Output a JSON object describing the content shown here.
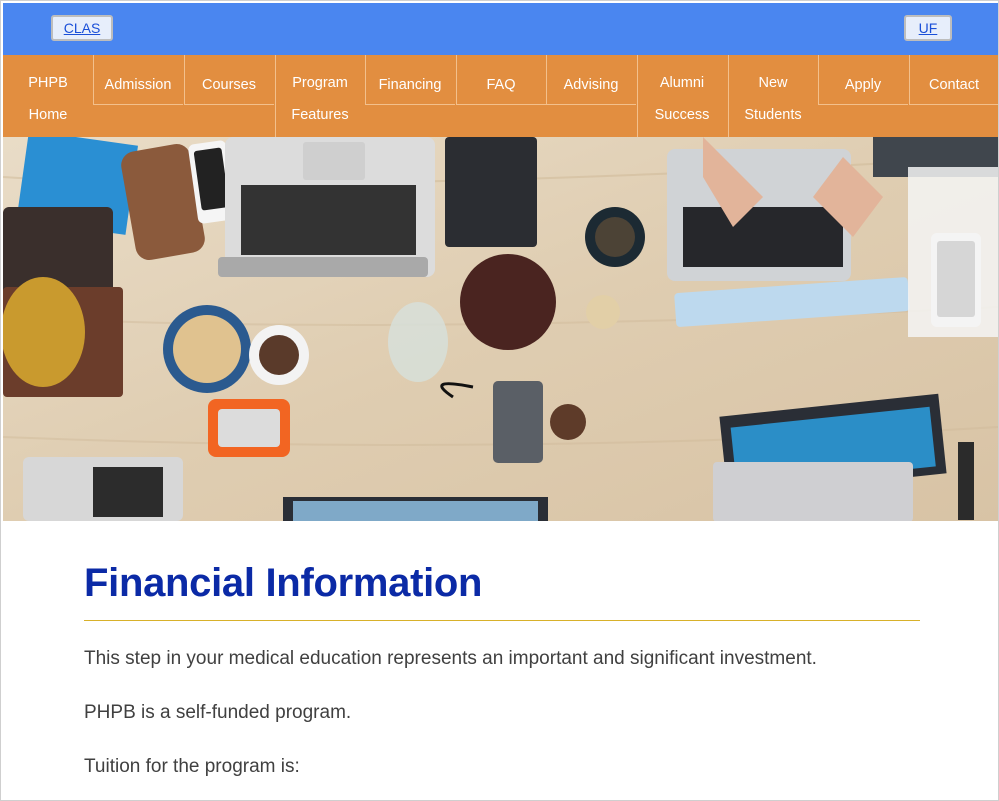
{
  "header": {
    "left_link": "CLAS",
    "right_link": "UF"
  },
  "nav": {
    "items": [
      {
        "label": "PHPB\nHome"
      },
      {
        "label": "Admission"
      },
      {
        "label": "Courses"
      },
      {
        "label": "Program\nFeatures"
      },
      {
        "label": "Financing"
      },
      {
        "label": "FAQ"
      },
      {
        "label": "Advising"
      },
      {
        "label": "Alumni\nSuccess"
      },
      {
        "label": "New\nStudents"
      },
      {
        "label": "Apply"
      },
      {
        "label": "Contact"
      }
    ]
  },
  "hero": {
    "icon": "desk-with-laptops-photo"
  },
  "main": {
    "title": "Financial Information",
    "paragraphs": [
      "This step in your medical education represents an important and significant investment.",
      "PHPB is a self-funded program.",
      "Tuition for the program is:"
    ]
  },
  "colors": {
    "topbar": "#4a86f0",
    "nav": "#e28e40",
    "title": "#0b2aa6",
    "rule": "#d8b12a"
  }
}
